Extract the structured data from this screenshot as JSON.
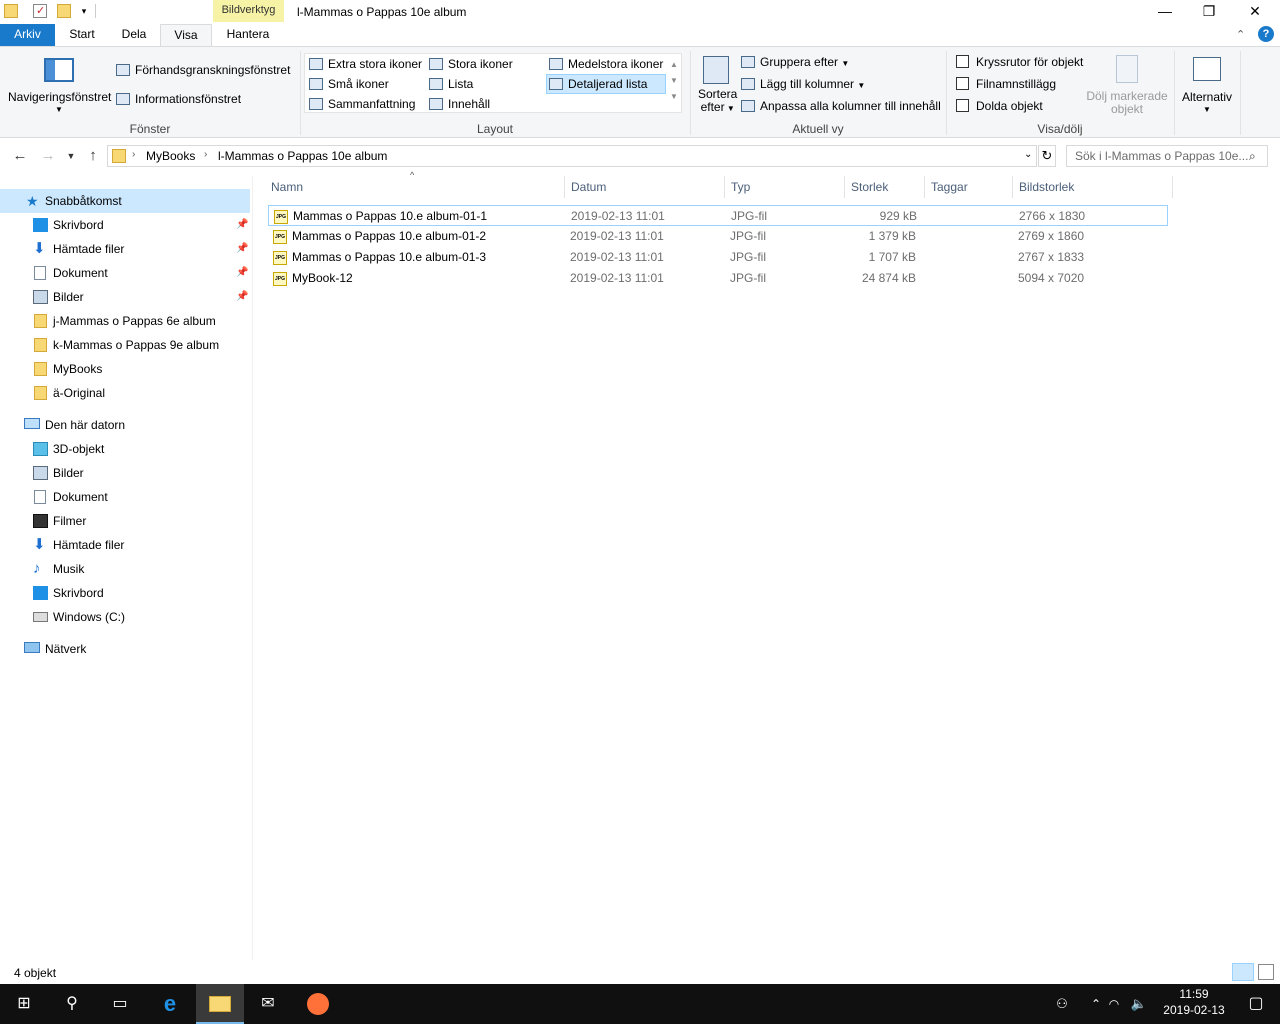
{
  "window": {
    "context_tab": "Bildverktyg",
    "title": "l-Mammas o Pappas 10e album",
    "controls": {
      "minimize": "—",
      "maximize": "❐",
      "close": "✕"
    }
  },
  "tabs": [
    {
      "label": "Arkiv"
    },
    {
      "label": "Start"
    },
    {
      "label": "Dela"
    },
    {
      "label": "Visa"
    },
    {
      "label": "Hantera"
    }
  ],
  "ribbon": {
    "fonster": {
      "label": "Fönster",
      "nav_pane": "Navigeringsfönstret",
      "preview_pane": "Förhandsgranskningsfönstret",
      "details_pane": "Informationsfönstret"
    },
    "layout": {
      "label": "Layout",
      "items": [
        "Extra stora ikoner",
        "Stora ikoner",
        "Medelstora ikoner",
        "Små ikoner",
        "Lista",
        "Detaljerad lista",
        "Sammanfattning",
        "Innehåll"
      ],
      "selected": "Detaljerad lista"
    },
    "aktuell_vy": {
      "label": "Aktuell vy",
      "sort_line1": "Sortera",
      "sort_line2": "efter",
      "group": "Gruppera efter",
      "add_columns": "Lägg till kolumner",
      "fit_columns": "Anpassa alla kolumner till innehåll"
    },
    "visa_dolj": {
      "label": "Visa/dölj",
      "checkboxes": [
        "Kryssrutor för objekt",
        "Filnamnstillägg",
        "Dolda objekt"
      ],
      "hide_line1": "Dölj markerade",
      "hide_line2": "objekt"
    },
    "alternativ": "Alternativ"
  },
  "address": {
    "crumbs": [
      "MyBooks",
      "l-Mammas o Pappas 10e album"
    ],
    "search_placeholder": "Sök i l-Mammas o Pappas 10e..."
  },
  "sidebar": {
    "quick_access": "Snabbåtkomst",
    "quick_items": [
      "Skrivbord",
      "Hämtade filer",
      "Dokument",
      "Bilder",
      "j-Mammas o Pappas 6e album",
      "k-Mammas o Pappas 9e album",
      "MyBooks",
      "ä-Original"
    ],
    "this_pc": "Den här datorn",
    "pc_items": [
      "3D-objekt",
      "Bilder",
      "Dokument",
      "Filmer",
      "Hämtade filer",
      "Musik",
      "Skrivbord",
      "Windows (C:)"
    ],
    "network": "Nätverk"
  },
  "columns": [
    "Namn",
    "Datum",
    "Typ",
    "Storlek",
    "Taggar",
    "Bildstorlek"
  ],
  "files": [
    {
      "name": "Mammas o Pappas 10.e album-01-1",
      "date": "2019-02-13 11:01",
      "type": "JPG-fil",
      "size": "929 kB",
      "dims": "2766 x 1830"
    },
    {
      "name": "Mammas o Pappas 10.e album-01-2",
      "date": "2019-02-13 11:01",
      "type": "JPG-fil",
      "size": "1 379 kB",
      "dims": "2769 x 1860"
    },
    {
      "name": "Mammas o Pappas 10.e album-01-3",
      "date": "2019-02-13 11:01",
      "type": "JPG-fil",
      "size": "1 707 kB",
      "dims": "2767 x 1833"
    },
    {
      "name": "MyBook-12",
      "date": "2019-02-13 11:01",
      "type": "JPG-fil",
      "size": "24 874 kB",
      "dims": "5094 x 7020"
    }
  ],
  "status": "4 objekt",
  "taskbar": {
    "time": "11:59",
    "date": "2019-02-13"
  },
  "colors": {
    "accent": "#1979ca",
    "selection": "#cce8ff",
    "context_tab": "#f7f3a6",
    "taskbar": "#101010"
  }
}
